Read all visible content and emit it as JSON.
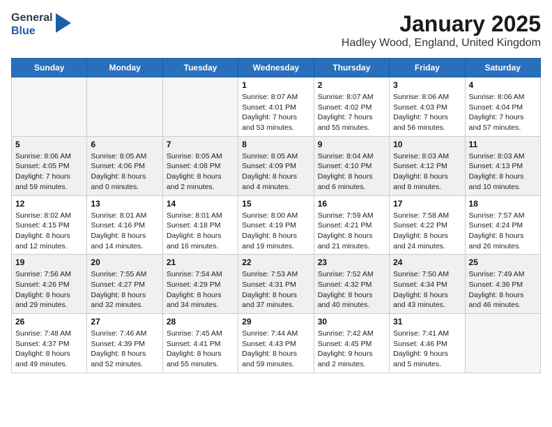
{
  "logo": {
    "line1": "General",
    "line2": "Blue"
  },
  "title": "January 2025",
  "location": "Hadley Wood, England, United Kingdom",
  "days_of_week": [
    "Sunday",
    "Monday",
    "Tuesday",
    "Wednesday",
    "Thursday",
    "Friday",
    "Saturday"
  ],
  "weeks": [
    [
      {
        "day": "",
        "info": ""
      },
      {
        "day": "",
        "info": ""
      },
      {
        "day": "",
        "info": ""
      },
      {
        "day": "1",
        "info": "Sunrise: 8:07 AM\nSunset: 4:01 PM\nDaylight: 7 hours\nand 53 minutes."
      },
      {
        "day": "2",
        "info": "Sunrise: 8:07 AM\nSunset: 4:02 PM\nDaylight: 7 hours\nand 55 minutes."
      },
      {
        "day": "3",
        "info": "Sunrise: 8:06 AM\nSunset: 4:03 PM\nDaylight: 7 hours\nand 56 minutes."
      },
      {
        "day": "4",
        "info": "Sunrise: 8:06 AM\nSunset: 4:04 PM\nDaylight: 7 hours\nand 57 minutes."
      }
    ],
    [
      {
        "day": "5",
        "info": "Sunrise: 8:06 AM\nSunset: 4:05 PM\nDaylight: 7 hours\nand 59 minutes."
      },
      {
        "day": "6",
        "info": "Sunrise: 8:05 AM\nSunset: 4:06 PM\nDaylight: 8 hours\nand 0 minutes."
      },
      {
        "day": "7",
        "info": "Sunrise: 8:05 AM\nSunset: 4:08 PM\nDaylight: 8 hours\nand 2 minutes."
      },
      {
        "day": "8",
        "info": "Sunrise: 8:05 AM\nSunset: 4:09 PM\nDaylight: 8 hours\nand 4 minutes."
      },
      {
        "day": "9",
        "info": "Sunrise: 8:04 AM\nSunset: 4:10 PM\nDaylight: 8 hours\nand 6 minutes."
      },
      {
        "day": "10",
        "info": "Sunrise: 8:03 AM\nSunset: 4:12 PM\nDaylight: 8 hours\nand 8 minutes."
      },
      {
        "day": "11",
        "info": "Sunrise: 8:03 AM\nSunset: 4:13 PM\nDaylight: 8 hours\nand 10 minutes."
      }
    ],
    [
      {
        "day": "12",
        "info": "Sunrise: 8:02 AM\nSunset: 4:15 PM\nDaylight: 8 hours\nand 12 minutes."
      },
      {
        "day": "13",
        "info": "Sunrise: 8:01 AM\nSunset: 4:16 PM\nDaylight: 8 hours\nand 14 minutes."
      },
      {
        "day": "14",
        "info": "Sunrise: 8:01 AM\nSunset: 4:18 PM\nDaylight: 8 hours\nand 16 minutes."
      },
      {
        "day": "15",
        "info": "Sunrise: 8:00 AM\nSunset: 4:19 PM\nDaylight: 8 hours\nand 19 minutes."
      },
      {
        "day": "16",
        "info": "Sunrise: 7:59 AM\nSunset: 4:21 PM\nDaylight: 8 hours\nand 21 minutes."
      },
      {
        "day": "17",
        "info": "Sunrise: 7:58 AM\nSunset: 4:22 PM\nDaylight: 8 hours\nand 24 minutes."
      },
      {
        "day": "18",
        "info": "Sunrise: 7:57 AM\nSunset: 4:24 PM\nDaylight: 8 hours\nand 26 minutes."
      }
    ],
    [
      {
        "day": "19",
        "info": "Sunrise: 7:56 AM\nSunset: 4:26 PM\nDaylight: 8 hours\nand 29 minutes."
      },
      {
        "day": "20",
        "info": "Sunrise: 7:55 AM\nSunset: 4:27 PM\nDaylight: 8 hours\nand 32 minutes."
      },
      {
        "day": "21",
        "info": "Sunrise: 7:54 AM\nSunset: 4:29 PM\nDaylight: 8 hours\nand 34 minutes."
      },
      {
        "day": "22",
        "info": "Sunrise: 7:53 AM\nSunset: 4:31 PM\nDaylight: 8 hours\nand 37 minutes."
      },
      {
        "day": "23",
        "info": "Sunrise: 7:52 AM\nSunset: 4:32 PM\nDaylight: 8 hours\nand 40 minutes."
      },
      {
        "day": "24",
        "info": "Sunrise: 7:50 AM\nSunset: 4:34 PM\nDaylight: 8 hours\nand 43 minutes."
      },
      {
        "day": "25",
        "info": "Sunrise: 7:49 AM\nSunset: 4:36 PM\nDaylight: 8 hours\nand 46 minutes."
      }
    ],
    [
      {
        "day": "26",
        "info": "Sunrise: 7:48 AM\nSunset: 4:37 PM\nDaylight: 8 hours\nand 49 minutes."
      },
      {
        "day": "27",
        "info": "Sunrise: 7:46 AM\nSunset: 4:39 PM\nDaylight: 8 hours\nand 52 minutes."
      },
      {
        "day": "28",
        "info": "Sunrise: 7:45 AM\nSunset: 4:41 PM\nDaylight: 8 hours\nand 55 minutes."
      },
      {
        "day": "29",
        "info": "Sunrise: 7:44 AM\nSunset: 4:43 PM\nDaylight: 8 hours\nand 59 minutes."
      },
      {
        "day": "30",
        "info": "Sunrise: 7:42 AM\nSunset: 4:45 PM\nDaylight: 9 hours\nand 2 minutes."
      },
      {
        "day": "31",
        "info": "Sunrise: 7:41 AM\nSunset: 4:46 PM\nDaylight: 9 hours\nand 5 minutes."
      },
      {
        "day": "",
        "info": ""
      }
    ]
  ]
}
